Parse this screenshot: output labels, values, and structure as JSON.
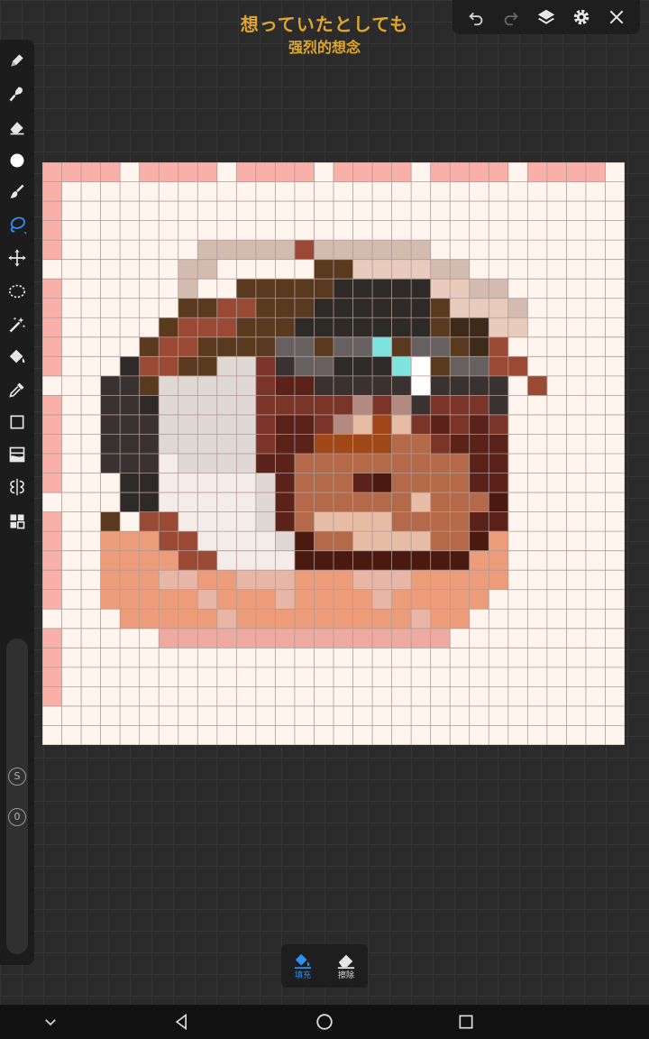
{
  "header": {
    "title": "想っていたとしても",
    "subtitle": "强烈的想念"
  },
  "topbar": {
    "buttons": [
      {
        "name": "undo-button",
        "icon": "undo-icon"
      },
      {
        "name": "redo-button",
        "icon": "redo-icon",
        "disabled": true
      },
      {
        "name": "layers-button",
        "icon": "layers-icon"
      },
      {
        "name": "settings-button",
        "icon": "gear-icon"
      },
      {
        "name": "close-button",
        "icon": "close-icon"
      }
    ]
  },
  "toolbar": {
    "tools": [
      {
        "name": "pencil-tool",
        "icon": "pencil-icon"
      },
      {
        "name": "brush-tool",
        "icon": "brush-icon"
      },
      {
        "name": "eraser-tool",
        "icon": "eraser-icon"
      },
      {
        "name": "color-tool",
        "icon": "color-circle-icon",
        "color": "#ffffff"
      },
      {
        "name": "smudge-tool",
        "icon": "smudge-icon"
      },
      {
        "name": "lasso-fill-tool",
        "icon": "lasso-icon",
        "active": true
      },
      {
        "name": "move-tool",
        "icon": "move-icon"
      },
      {
        "name": "selection-tool",
        "icon": "selection-icon"
      },
      {
        "name": "magic-wand-tool",
        "icon": "magic-wand-icon"
      },
      {
        "name": "fill-tool",
        "icon": "paint-bucket-icon"
      },
      {
        "name": "eyedropper-tool",
        "icon": "eyedropper-icon"
      },
      {
        "name": "rectangle-tool",
        "icon": "rectangle-icon"
      },
      {
        "name": "gradient-tool",
        "icon": "gradient-icon"
      },
      {
        "name": "symmetry-tool",
        "icon": "symmetry-icon"
      },
      {
        "name": "grid-tool",
        "icon": "grid-icon"
      }
    ],
    "slider_badges": [
      "S",
      "0"
    ]
  },
  "canvas": {
    "grid_size": 30,
    "grid_color": "#b09a96",
    "background": "#fff5ee"
  },
  "bottom_panel": {
    "items": [
      {
        "label": "填充",
        "icon": "paint-bucket-icon",
        "active": true
      },
      {
        "label": "擦除",
        "icon": "eraser-icon",
        "active": false
      }
    ]
  },
  "navbar": {
    "buttons": [
      "chevron-down-icon",
      "back-icon",
      "home-icon",
      "recents-icon"
    ]
  },
  "colors": {
    "accent": "#2f8ff0",
    "title": "#e0a62e",
    "toolbar_bg": "#1c1c1c"
  }
}
